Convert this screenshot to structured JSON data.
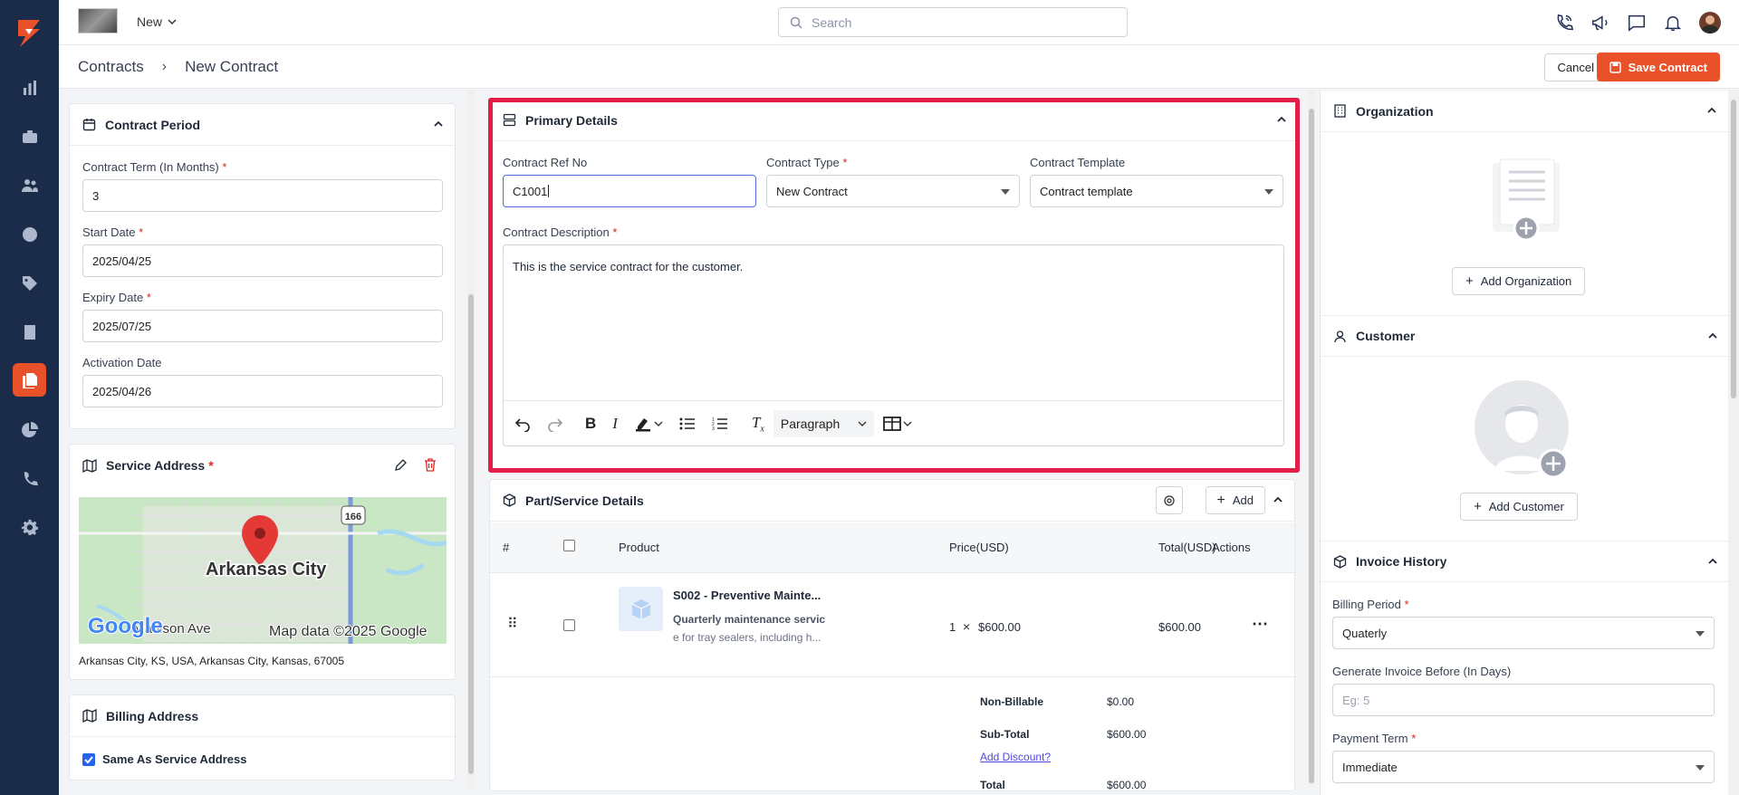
{
  "topbar": {
    "new_label": "New",
    "search_placeholder": "Search"
  },
  "breadcrumb": {
    "root": "Contracts",
    "current": "New Contract"
  },
  "actions": {
    "cancel": "Cancel",
    "save": "Save Contract"
  },
  "contract_period": {
    "title": "Contract Period",
    "term_label": "Contract Term (In Months)",
    "term_value": "3",
    "start_label": "Start Date",
    "start_value": "2025/04/25",
    "expiry_label": "Expiry Date",
    "expiry_value": "2025/07/25",
    "activation_label": "Activation Date",
    "activation_value": "2025/04/26"
  },
  "service_address": {
    "title": "Service Address",
    "map_city": "Arkansas City",
    "map_route": "166",
    "map_street": "Madison Ave",
    "map_brand": "Google",
    "map_credit": "Map data ©2025 Google",
    "address": "Arkansas City, KS, USA, Arkansas City, Kansas, 67005"
  },
  "billing_address": {
    "title": "Billing Address",
    "same_label": "Same As Service Address",
    "same_checked": true
  },
  "primary_details": {
    "title": "Primary Details",
    "ref_label": "Contract Ref No",
    "ref_value": "C1001",
    "type_label": "Contract Type",
    "type_value": "New Contract",
    "template_label": "Contract Template",
    "template_value": "Contract template",
    "desc_label": "Contract Description",
    "desc_value": "This is the service contract for the customer.",
    "paragraph_label": "Paragraph"
  },
  "parts": {
    "title": "Part/Service Details",
    "add_label": "Add",
    "columns": [
      "#",
      "Product",
      "Price(USD)",
      "Total(USD)",
      "Actions"
    ],
    "item": {
      "name": "S002 - Preventive Mainte...",
      "desc1": "Quarterly maintenance servic",
      "desc2": "e for tray sealers, including h...",
      "qty": "1",
      "times": "×",
      "price": "$600.00",
      "total": "$600.00"
    },
    "non_billable_label": "Non-Billable",
    "non_billable_value": "$0.00",
    "subtotal_label": "Sub-Total",
    "subtotal_value": "$600.00",
    "add_discount": "Add Discount?",
    "total_label": "Total",
    "total_value": "$600.00"
  },
  "organization": {
    "title": "Organization",
    "add_label": "Add Organization"
  },
  "customer": {
    "title": "Customer",
    "add_label": "Add Customer"
  },
  "invoice_history": {
    "title": "Invoice History",
    "billing_label": "Billing Period",
    "billing_value": "Quaterly",
    "generate_label": "Generate Invoice Before (In Days)",
    "generate_placeholder": "Eg: 5",
    "payment_label": "Payment Term",
    "payment_value": "Immediate"
  },
  "colors": {
    "sidebar": "#1b2b4a",
    "accent": "#e8512a",
    "highlight": "#e11d48"
  }
}
